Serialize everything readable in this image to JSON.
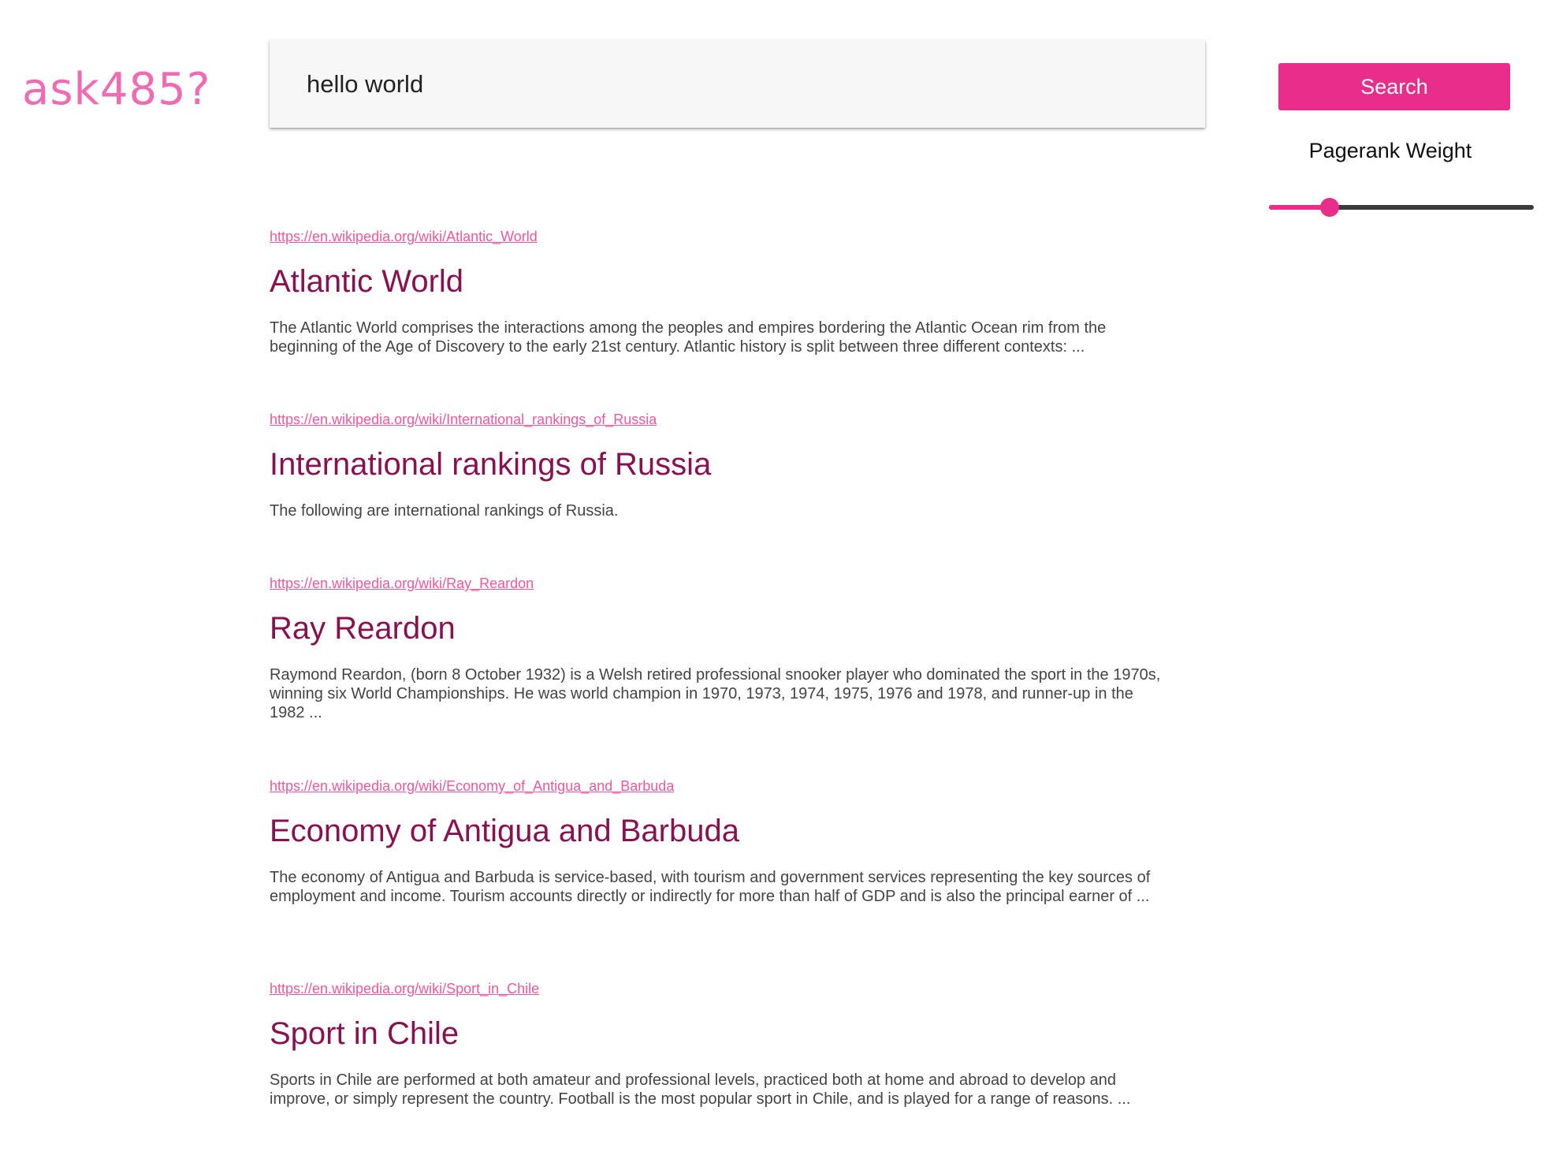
{
  "logo": {
    "prefix": "ask",
    "number": "485?"
  },
  "search": {
    "query": "hello world",
    "button_label": "Search"
  },
  "pagerank": {
    "label": "Pagerank Weight",
    "value": 0.23
  },
  "colors": {
    "accent": "#e92d8a",
    "logo": "#f06bb4",
    "title": "#8a1150",
    "url": "#f0589e",
    "slider_track": "#3a3a3a"
  },
  "results": [
    {
      "url": "https://en.wikipedia.org/wiki/Atlantic_World",
      "title": "Atlantic World",
      "snippet": "The Atlantic World comprises the interactions among the peoples and empires bordering the Atlantic Ocean rim from the beginning of the Age of Discovery to the early 21st century. Atlantic history is split between three different contexts: ..."
    },
    {
      "url": "https://en.wikipedia.org/wiki/International_rankings_of_Russia",
      "title": "International rankings of Russia",
      "snippet": "The following are international rankings of Russia."
    },
    {
      "url": "https://en.wikipedia.org/wiki/Ray_Reardon",
      "title": "Ray Reardon",
      "snippet": "Raymond Reardon, (born 8 October 1932) is a Welsh retired professional snooker player who dominated the sport in the 1970s, winning six World Championships. He was world champion in 1970, 1973, 1974, 1975, 1976 and 1978, and runner-up in the 1982 ..."
    },
    {
      "url": "https://en.wikipedia.org/wiki/Economy_of_Antigua_and_Barbuda",
      "title": "Economy of Antigua and Barbuda",
      "snippet": "The economy of Antigua and Barbuda is service-based, with tourism and government services representing the key sources of employment and income. Tourism accounts directly or indirectly for more than half of GDP and is also the principal earner of ..."
    },
    {
      "url": "https://en.wikipedia.org/wiki/Sport_in_Chile",
      "title": "Sport in Chile",
      "snippet": "Sports in Chile are performed at both amateur and professional levels, practiced both at home and abroad to develop and improve, or simply represent the country. Football is the most popular sport in Chile, and is played for a range of reasons. ..."
    }
  ]
}
